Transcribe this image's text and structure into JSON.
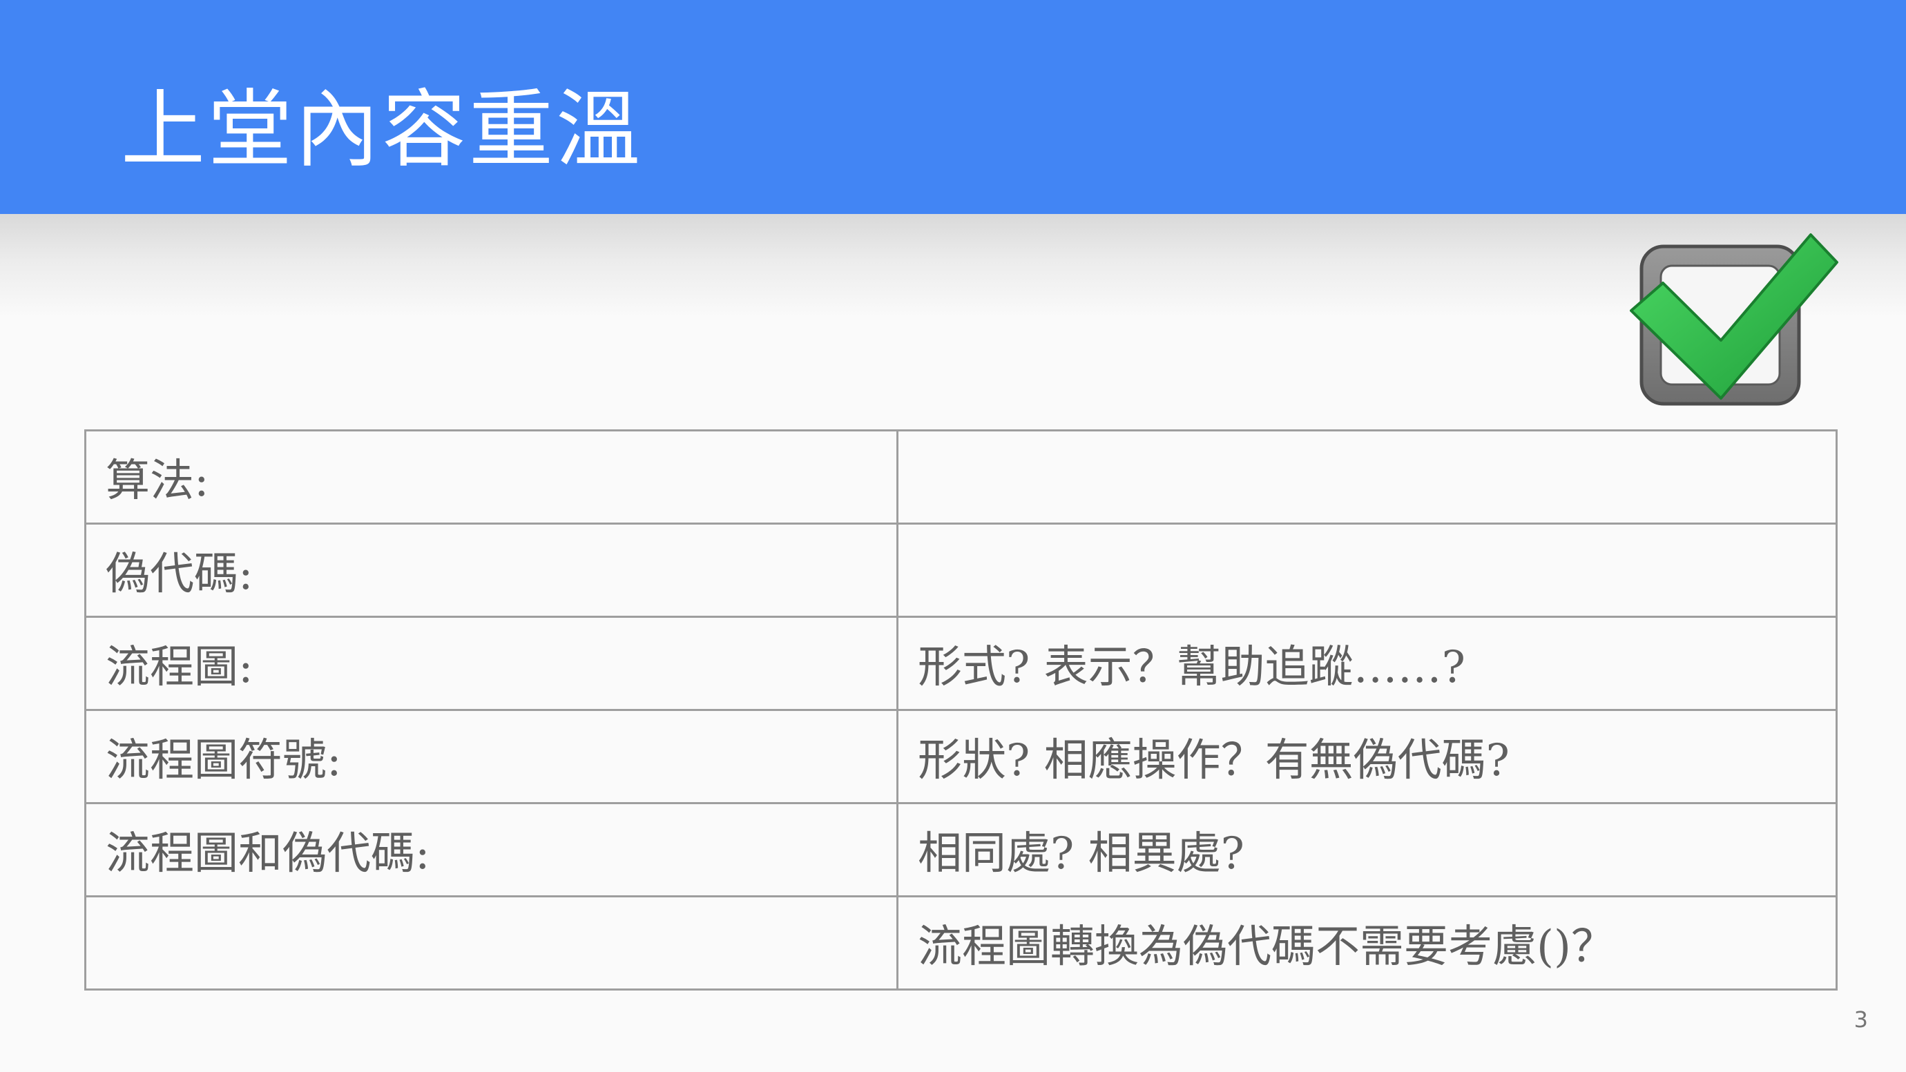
{
  "slide": {
    "title": "上堂內容重溫",
    "page_number": "3"
  },
  "icon": {
    "name": "checkbox-checked-icon",
    "check_color": "#2db24a",
    "box_color": "#808080"
  },
  "colors": {
    "header": "#4285f4",
    "text": "#5f5f5f",
    "table_border": "#9e9e9e"
  },
  "table": {
    "rows": [
      {
        "label": "算法:",
        "note": ""
      },
      {
        "label": "偽代碼:",
        "note": ""
      },
      {
        "label": "流程圖:",
        "note": "形式? 表示？幫助追蹤……?"
      },
      {
        "label": "流程圖符號:",
        "note": "形狀? 相應操作？有無偽代碼?"
      },
      {
        "label": "流程圖和偽代碼:",
        "note": "相同處? 相異處?"
      },
      {
        "label": "",
        "note": "流程圖轉換為偽代碼不需要考慮()？"
      }
    ]
  }
}
